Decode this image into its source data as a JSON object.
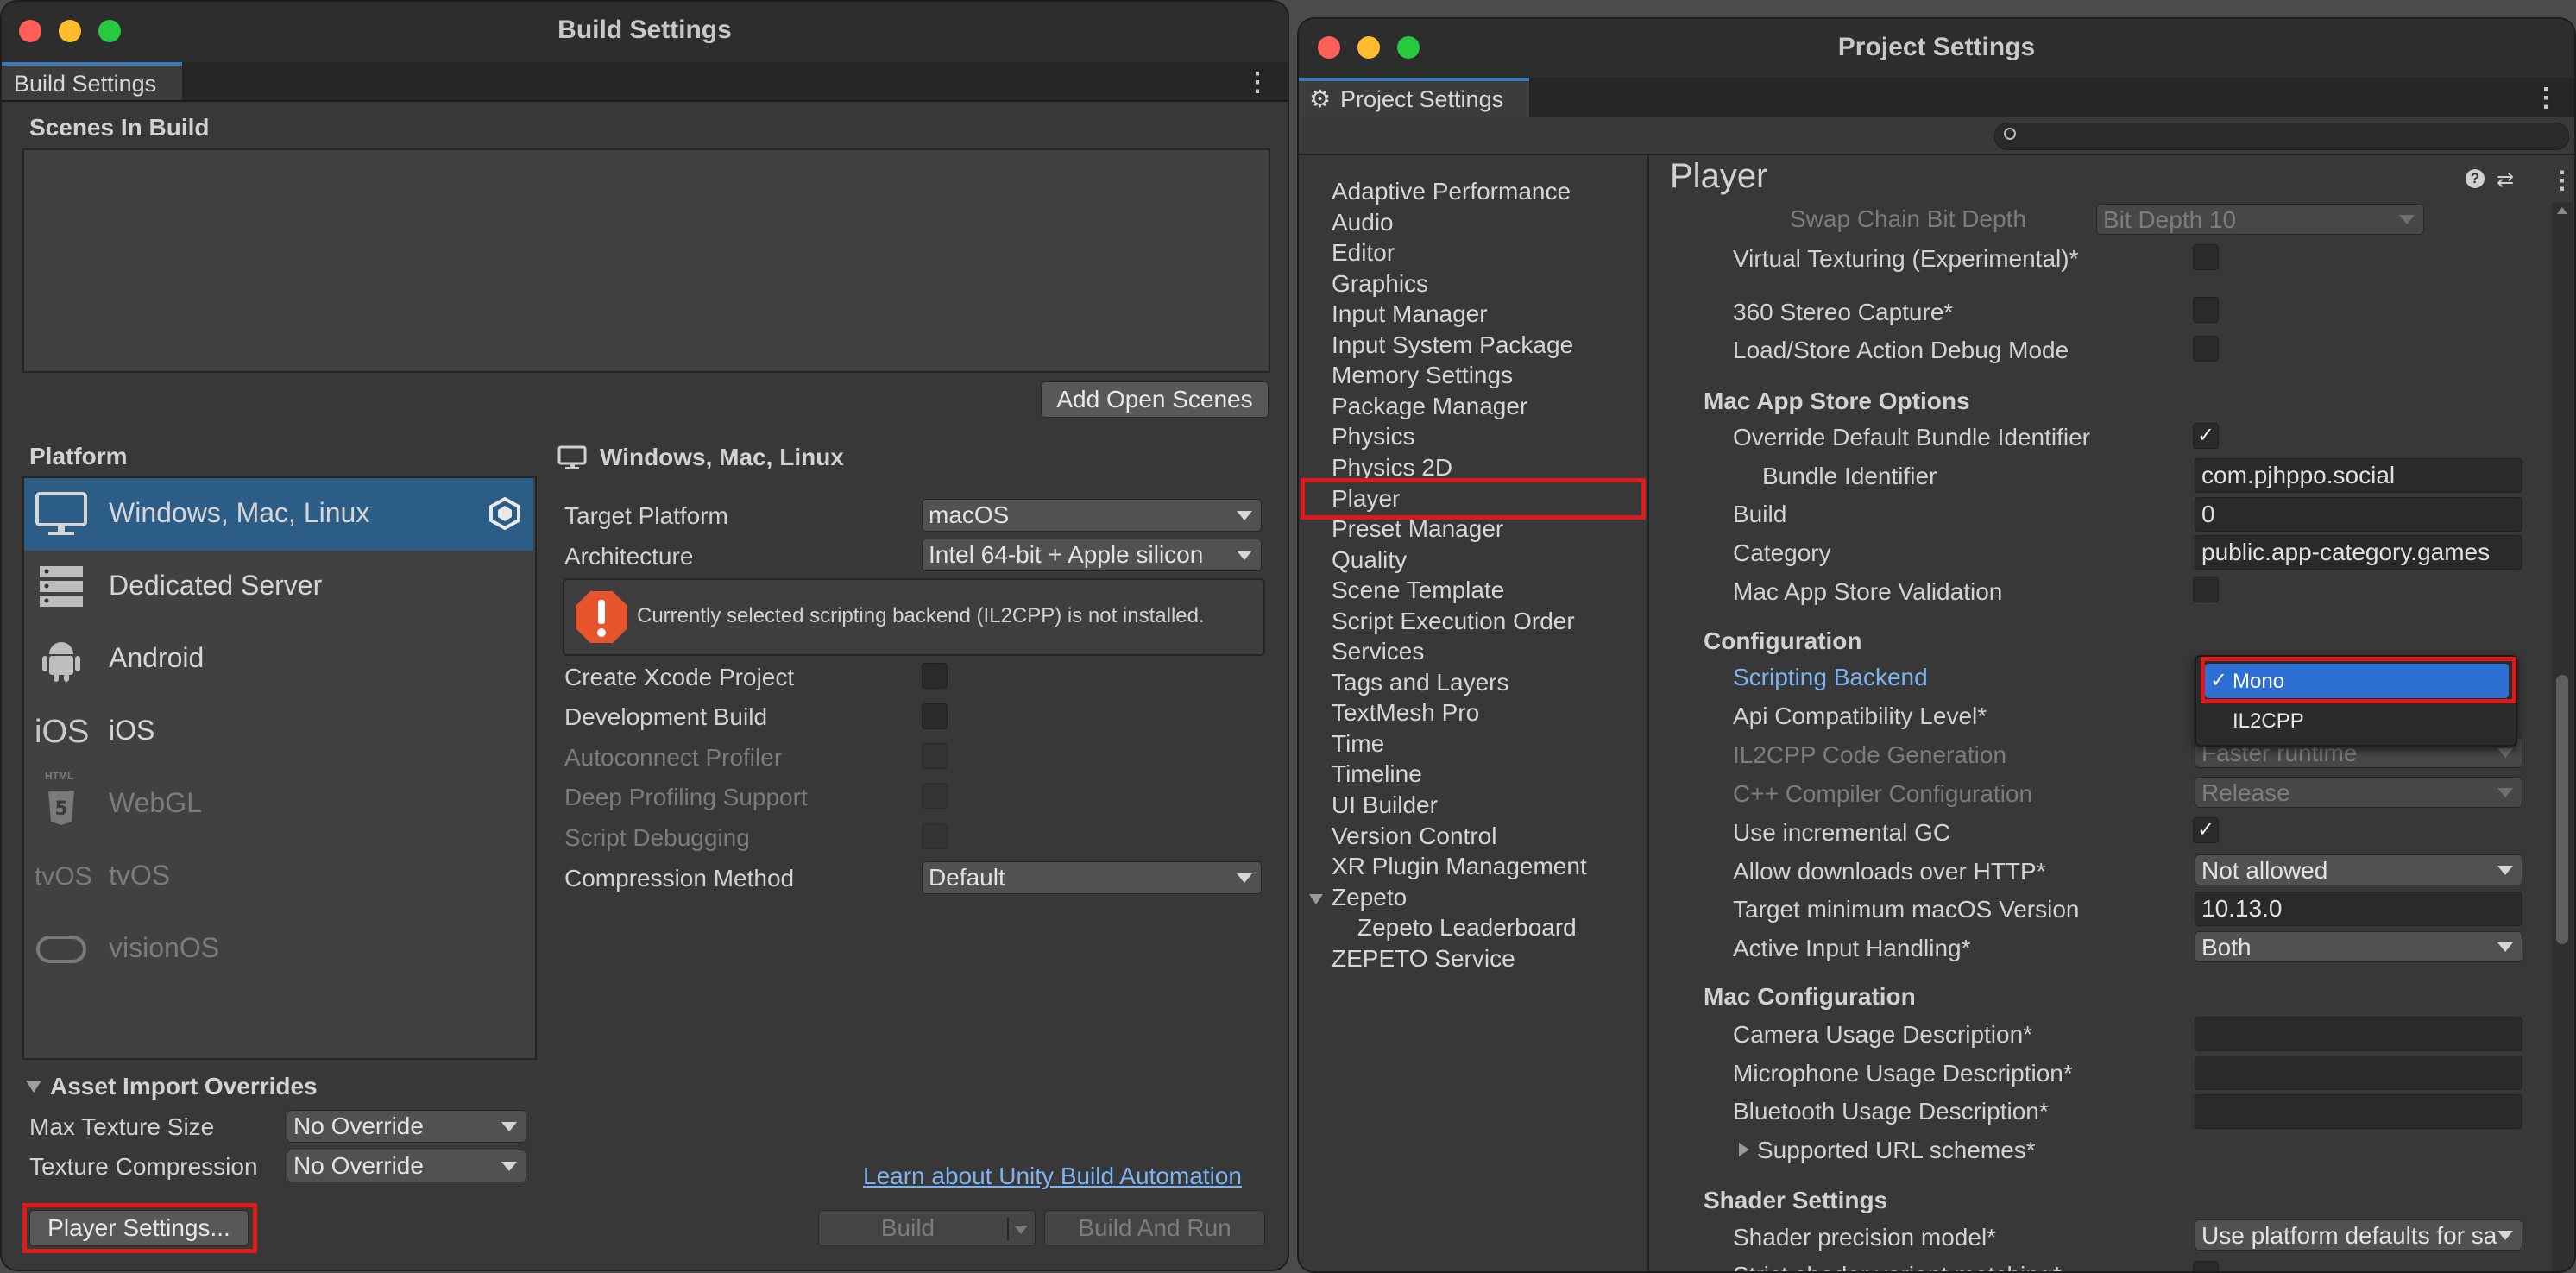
{
  "build": {
    "window_title": "Build Settings",
    "tab": "Build Settings",
    "scenes_header": "Scenes In Build",
    "add_open_scenes": "Add Open Scenes",
    "platform_header": "Platform",
    "platforms": [
      {
        "label": "Windows, Mac, Linux",
        "icon": "monitor-icon",
        "icon_text": ""
      },
      {
        "label": "Dedicated Server",
        "icon": "server-icon",
        "icon_text": ""
      },
      {
        "label": "Android",
        "icon": "android-icon",
        "icon_text": ""
      },
      {
        "label": "iOS",
        "icon": "ios-icon",
        "icon_text": "iOS"
      },
      {
        "label": "WebGL",
        "icon": "html5-icon",
        "icon_text": "HTML"
      },
      {
        "label": "tvOS",
        "icon": "tvos-icon",
        "icon_text": "tvOS"
      },
      {
        "label": "visionOS",
        "icon": "visionos-icon",
        "icon_text": ""
      }
    ],
    "selected_platform_title": "Windows, Mac, Linux",
    "settings": [
      {
        "label": "Target Platform",
        "value": "macOS"
      },
      {
        "label": "Architecture",
        "value": "Intel 64-bit + Apple silicon"
      }
    ],
    "warning": "Currently selected scripting backend (IL2CPP) is not installed.",
    "options": [
      {
        "label": "Create Xcode Project"
      },
      {
        "label": "Development Build"
      },
      {
        "label": "Autoconnect Profiler"
      },
      {
        "label": "Deep Profiling Support"
      },
      {
        "label": "Script Debugging"
      }
    ],
    "compression_label": "Compression Method",
    "compression_value": "Default",
    "asset_overrides_header": "Asset Import Overrides",
    "max_texture_label": "Max Texture Size",
    "max_texture_value": "No Override",
    "texture_compression_label": "Texture Compression",
    "texture_compression_value": "No Override",
    "learn_link": "Learn about Unity Build Automation",
    "player_settings_button": "Player Settings...",
    "build_button": "Build",
    "build_and_run_button": "Build And Run"
  },
  "project": {
    "window_title": "Project Settings",
    "tab": "Project Settings",
    "nav": [
      "Adaptive Performance",
      "Audio",
      "Editor",
      "Graphics",
      "Input Manager",
      "Input System Package",
      "Memory Settings",
      "Package Manager",
      "Physics",
      "Physics 2D",
      "Player",
      "Preset Manager",
      "Quality",
      "Scene Template",
      "Script Execution Order",
      "Services",
      "Tags and Layers",
      "TextMesh Pro",
      "Time",
      "Timeline",
      "UI Builder",
      "Version Control",
      "XR Plugin Management",
      "Zepeto",
      "Zepeto Leaderboard",
      "ZEPETO Service"
    ],
    "panel_title": "Player",
    "rows": {
      "swap_chain_label": "Swap Chain Bit Depth",
      "swap_chain_value": "Bit Depth 10",
      "virtual_texturing": "Virtual Texturing (Experimental)*",
      "stereo_capture": "360 Stereo Capture*",
      "load_store": "Load/Store Action Debug Mode",
      "mac_app_store_header": "Mac App Store Options",
      "override_bundle": "Override Default Bundle Identifier",
      "bundle_id_label": "Bundle Identifier",
      "bundle_id_value": "com.pjhppo.social",
      "build_label": "Build",
      "build_value": "0",
      "category_label": "Category",
      "category_value": "public.app-category.games",
      "store_validation": "Mac App Store Validation",
      "configuration_header": "Configuration",
      "scripting_backend": "Scripting Backend",
      "api_compat": "Api Compatibility Level*",
      "il2cpp_codegen": "IL2CPP Code Generation",
      "il2cpp_codegen_value": "Faster runtime",
      "cpp_compiler": "C++ Compiler Configuration",
      "cpp_compiler_value": "Release",
      "incremental_gc": "Use incremental GC",
      "allow_http": "Allow downloads over HTTP*",
      "allow_http_value": "Not allowed",
      "target_macos": "Target minimum macOS Version",
      "target_macos_value": "10.13.0",
      "active_input": "Active Input Handling*",
      "active_input_value": "Both",
      "mac_config_header": "Mac Configuration",
      "camera_usage": "Camera Usage Description*",
      "microphone_usage": "Microphone Usage Description*",
      "bluetooth_usage": "Bluetooth Usage Description*",
      "url_schemes": "Supported URL schemes*",
      "shader_header": "Shader Settings",
      "shader_precision": "Shader precision model*",
      "shader_precision_value": "Use platform defaults for sa",
      "strict_shader": "Strict shader variant matching*"
    },
    "backend_popup": {
      "selected": "Mono",
      "options": [
        "Mono",
        "IL2CPP"
      ]
    }
  }
}
